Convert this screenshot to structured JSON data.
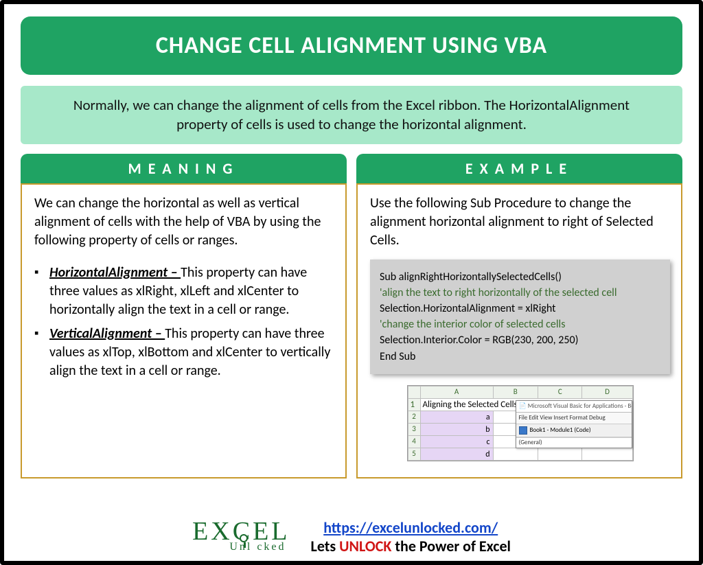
{
  "title": "CHANGE CELL ALIGNMENT USING VBA",
  "intro": "Normally, we can change the alignment of cells from the Excel ribbon. The HorizontalAlignment property of cells is used to change the horizontal alignment.",
  "meaning": {
    "header": "MEANING",
    "lead": "We can change the horizontal as well as vertical alignment of cells with the help of VBA by using the following property of cells or ranges.",
    "items": [
      {
        "term": "HorizontalAlignment – ",
        "desc": "This property can have three values as xlRight, xlLeft and xlCenter to horizontally align the text in a cell or range."
      },
      {
        "term": "VerticalAlignment – ",
        "desc": "This property can have three values as xlTop, xlBottom and xlCenter to vertically align the text in a cell or range."
      }
    ]
  },
  "example": {
    "header": "EXAMPLE",
    "lead": "Use the following Sub Procedure to change the alignment horizontal alignment to right of Selected Cells.",
    "code": {
      "l1": "Sub alignRightHorizontallySelectedCells()",
      "l2": "'align the text to right horizontally of the selected cell",
      "l3": "Selection.HorizontalAlignment = xlRight",
      "l4": "'change the interior color of selected cells",
      "l5": "Selection.Interior.Color = RGB(230, 200, 250)",
      "l6": "End Sub"
    },
    "shot": {
      "cols": [
        "A",
        "B",
        "C",
        "D"
      ],
      "rows": [
        "1",
        "2",
        "3",
        "4",
        "5"
      ],
      "titleRow": "Aligning the Selected Cells to Right",
      "vals": [
        "a",
        "b",
        "c",
        "d"
      ],
      "vbeTitle": "Microsoft Visual Basic for Applications - Bo",
      "vbeMenu": "File  Edit  View  Insert  Format  Debug",
      "vbeModule": "Book1 - Module1 (Code)",
      "vbeDrop": "(General)"
    }
  },
  "footer": {
    "logo1": "EXCEL",
    "logo2": "Unl   cked",
    "url": "https://excelunlocked.com/",
    "tag_a": "Lets ",
    "tag_b": "UNLOCK",
    "tag_c": " the Power of Excel"
  }
}
